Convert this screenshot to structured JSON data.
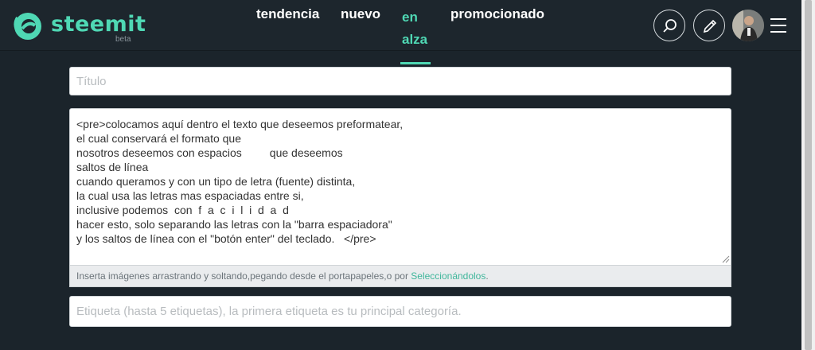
{
  "header": {
    "brand": "steemit",
    "beta": "beta",
    "nav": {
      "trending": "tendencia",
      "new": "nuevo",
      "hot": "en alza",
      "promoted": "promocionado"
    },
    "icons": {
      "logo": "steemit-logo-icon",
      "search": "search-icon",
      "write": "pencil-icon",
      "menu": "hamburger-menu-icon"
    }
  },
  "colors": {
    "accent": "#4fd8b4",
    "background": "#1b242b",
    "link": "#3fb69b"
  },
  "editor": {
    "title_placeholder": "Título",
    "body_value": "<pre>colocamos aquí dentro el texto que deseemos preformatear,\nel cual conservará el formato que\nnosotros deseemos con espacios         que deseemos\nsaltos de línea\ncuando queramos y con un tipo de letra (fuente) distinta,\nla cual usa las letras mas espaciadas entre si,\ninclusive podemos  con  f  a  c  i  l  i  d  a  d\nhacer esto, solo separando las letras con la \"barra espaciadora\"\ny los saltos de línea con el \"botón enter\" del teclado.   </pre>",
    "hint_text": "Inserta imágenes arrastrando y soltando,pegando desde el portapapeles,o por ",
    "hint_link": "Seleccionándolos",
    "hint_end": ".",
    "tags_placeholder": "Etiqueta (hasta 5 etiquetas), la primera etiqueta es tu principal categoría."
  }
}
